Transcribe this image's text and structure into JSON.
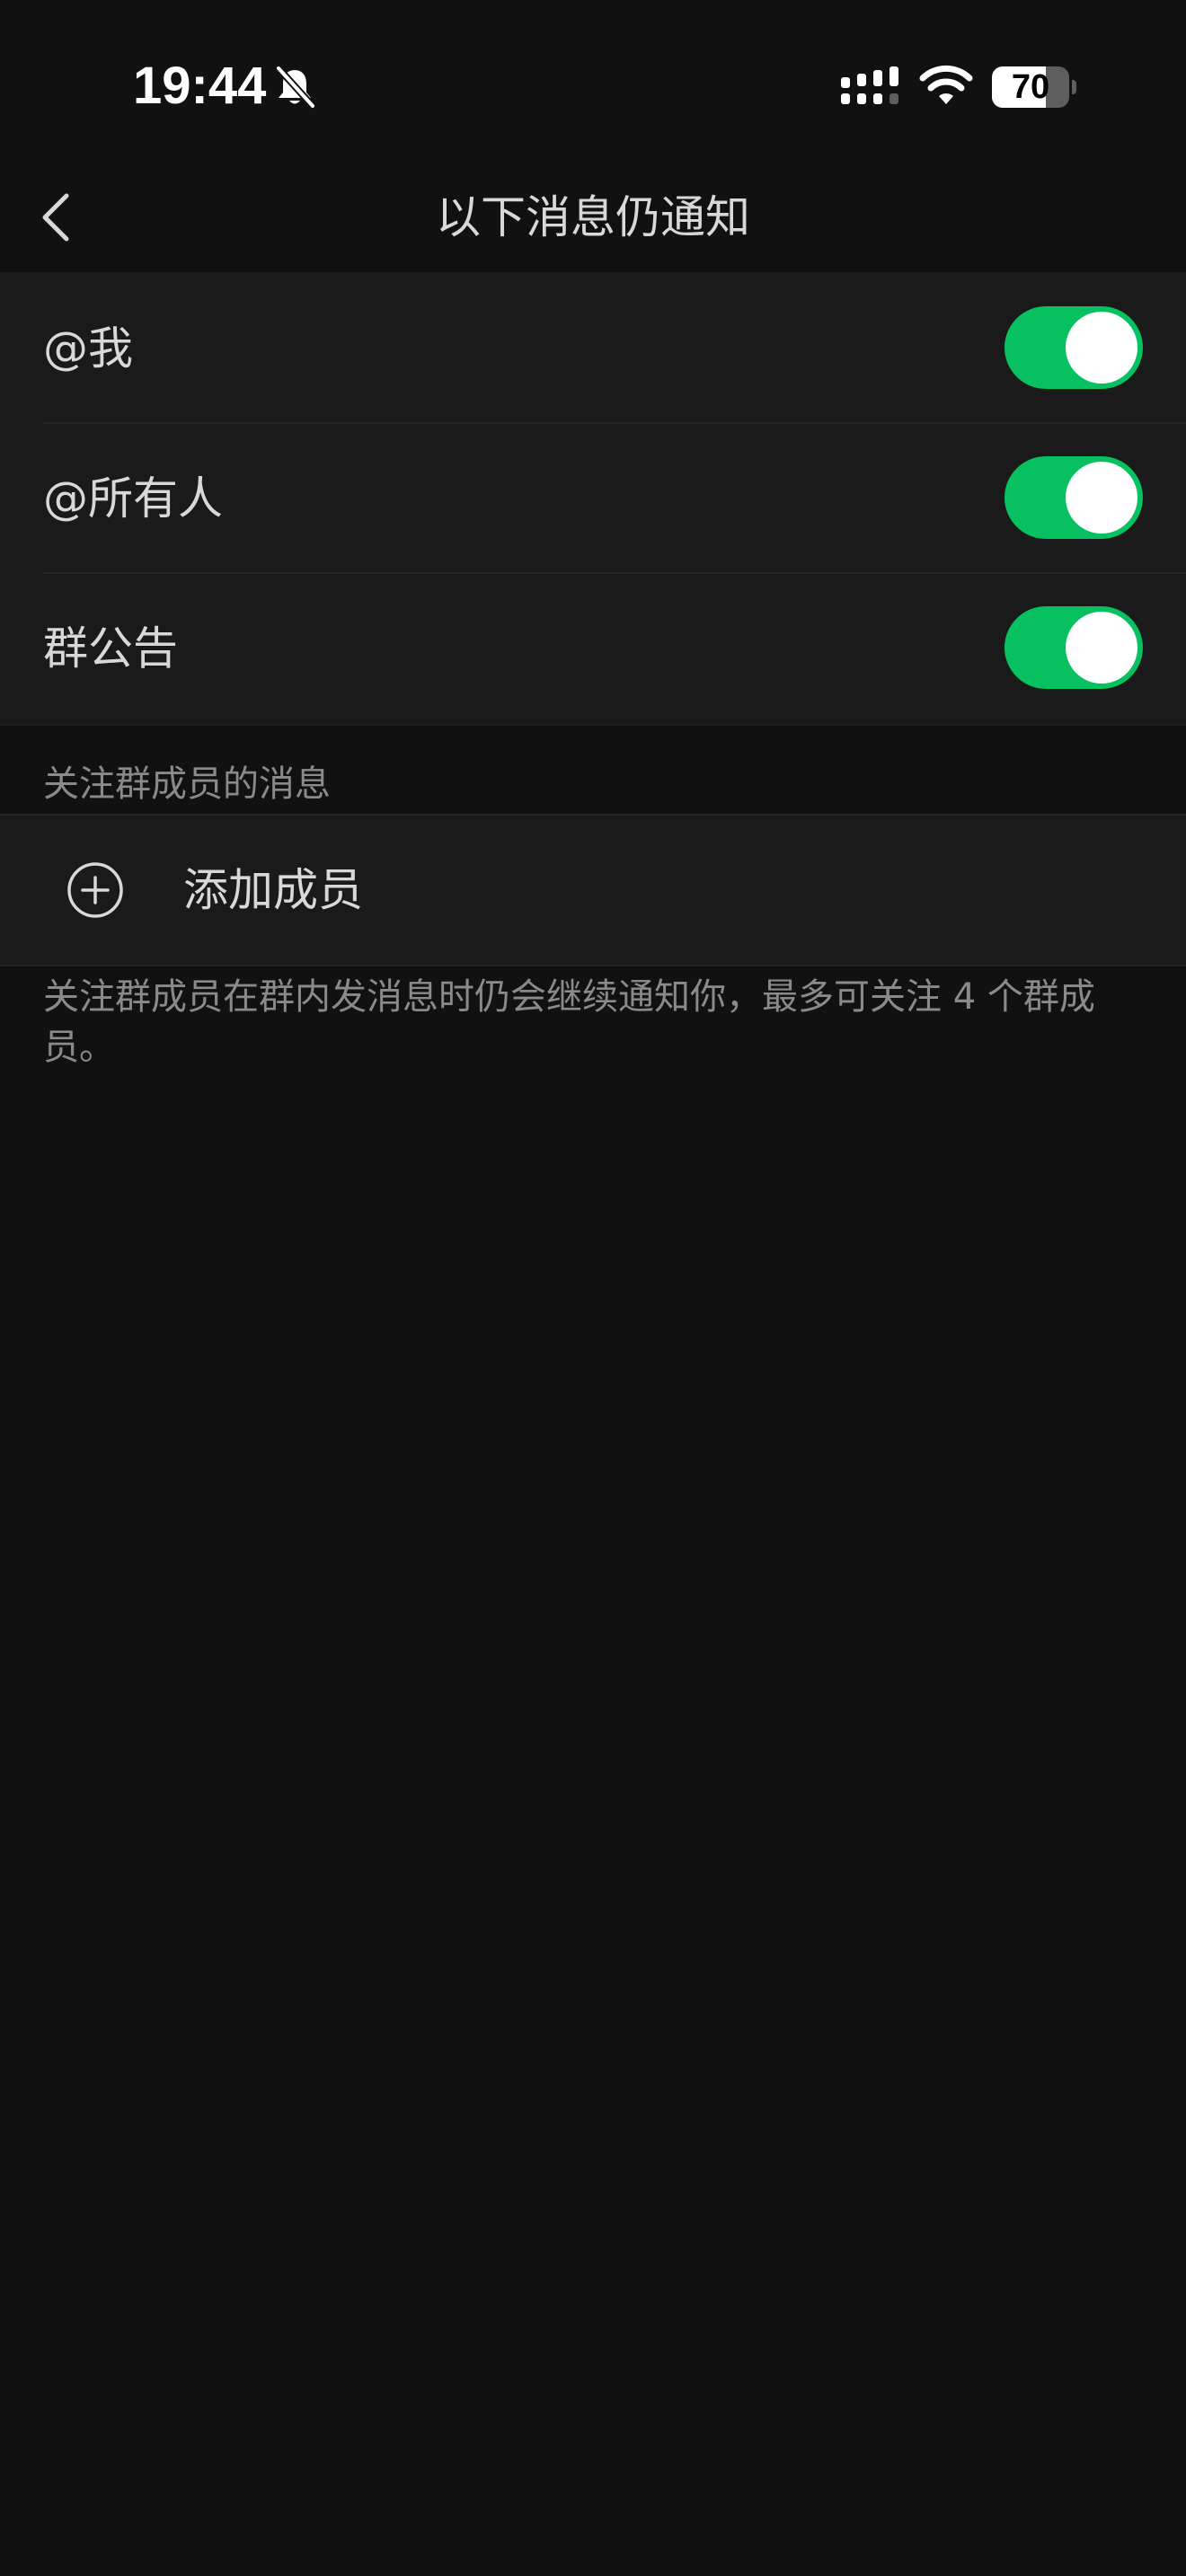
{
  "status_bar": {
    "time": "19:44",
    "battery_level": "70",
    "battery_fraction": 0.7,
    "icons": [
      "bell-slash-icon",
      "cellular-signal-icon",
      "wifi-icon",
      "battery-icon"
    ]
  },
  "nav": {
    "title": "以下消息仍通知",
    "back_icon": "chevron-left-icon"
  },
  "settings": {
    "items": [
      {
        "label": "@我",
        "enabled": true
      },
      {
        "label": "@所有人",
        "enabled": true
      },
      {
        "label": "群公告",
        "enabled": true
      }
    ]
  },
  "follow_section": {
    "header": "关注群成员的消息",
    "add_label": "添加成员",
    "add_icon": "plus-circle-icon",
    "footer": "关注群成员在群内发消息时仍会继续通知你，最多可关注 4 个群成员。"
  },
  "colors": {
    "background": "#111111",
    "cell": "#1a1a1a",
    "toggle_on": "#07c160",
    "text_primary": "#d8d8d8",
    "text_secondary": "#8a8a8a"
  }
}
